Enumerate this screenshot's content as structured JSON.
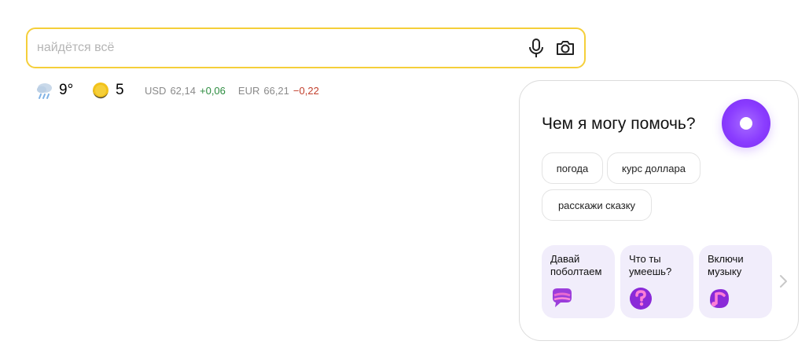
{
  "search": {
    "placeholder": "найдётся всё",
    "value": ""
  },
  "weather": {
    "temperature": "9°",
    "icon": "rain-cloud-icon"
  },
  "traffic": {
    "score": "5",
    "icon": "traffic-light-icon"
  },
  "rates": [
    {
      "currency": "USD",
      "value": "62,14",
      "change": "+0,06",
      "trend": "up"
    },
    {
      "currency": "EUR",
      "value": "66,21",
      "change": "−0,22",
      "trend": "down"
    }
  ],
  "alice": {
    "title": "Чем я могу помочь?",
    "chips": [
      "погода",
      "курс доллара",
      "расскажи сказку"
    ],
    "tiles": [
      {
        "label": "Давай поболтаем",
        "icon": "chat-bubble-icon"
      },
      {
        "label": "Что ты умеешь?",
        "icon": "question-icon"
      },
      {
        "label": "Включи музыку",
        "icon": "music-note-icon"
      }
    ]
  },
  "colors": {
    "search_border": "#f5cf3a",
    "alice_purple": "#8a3cff",
    "tile_bg": "#f1edfb",
    "rate_up": "#2c8c3f",
    "rate_down": "#c2402d"
  }
}
